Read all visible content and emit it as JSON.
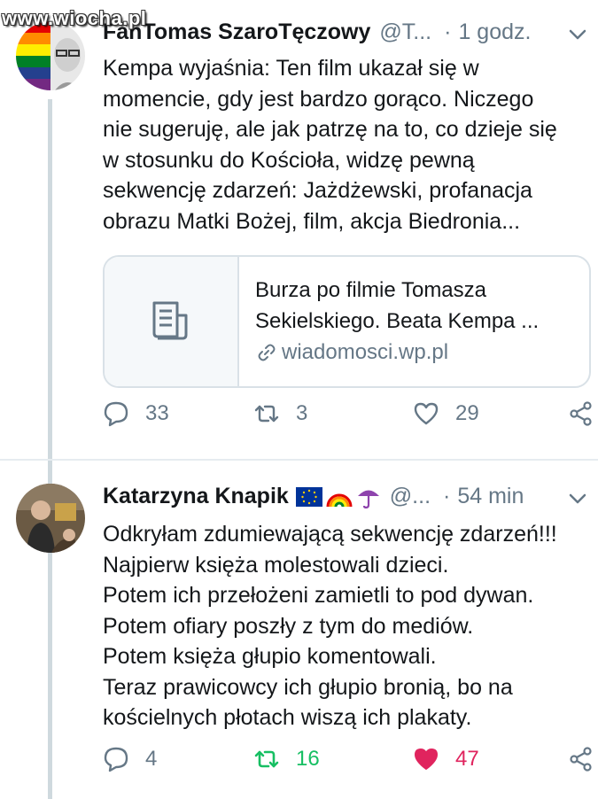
{
  "watermark": "www.wiocha.pl",
  "tweets": [
    {
      "display_name": "FanTomas SzaroTęczowy",
      "handle": "@T...",
      "separator": "·",
      "time": "1 godz.",
      "body_lines": [
        "Kempa wyjaśnia:  Ten film ukazał się w",
        "momencie, gdy jest bardzo gorąco. Niczego",
        "nie sugeruję, ale jak patrzę na to, co dzieje się",
        "w stosunku do Kościoła, widzę pewną",
        "sekwencję zdarzeń: Jażdżewski, profanacja",
        "obrazu Matki Bożej, film, akcja Biedronia..."
      ],
      "card": {
        "title_lines": [
          "Burza po filmie Tomasza",
          "Sekielskiego. Beata Kempa ..."
        ],
        "domain": "wiadomosci.wp.pl",
        "icon": "document-icon"
      },
      "replies": "33",
      "retweets": "3",
      "likes": "29"
    },
    {
      "display_name": "Katarzyna Knapik",
      "handle": "@...",
      "separator": "·",
      "time": "54 min",
      "emojis": [
        "eu-flag-icon",
        "rainbow-icon",
        "umbrella-icon"
      ],
      "body_lines": [
        "Odkryłam zdumiewającą sekwencję zdarzeń!!!",
        "Najpierw księża molestowali dzieci.",
        "Potem ich przełożeni zamietli to pod dywan.",
        "Potem ofiary poszły z tym do mediów.",
        "Potem księża głupio komentowali.",
        "Teraz prawicowcy ich głupio bronią, bo na",
        "kościelnych płotach wiszą ich plakaty."
      ],
      "replies": "4",
      "retweets": "16",
      "likes": "47",
      "retweeted": true,
      "liked": true
    }
  ],
  "colors": {
    "text": "#14171a",
    "muted": "#657786",
    "retweet_active": "#17bf63",
    "like_active": "#e0245e",
    "border": "#d9e1e7"
  }
}
